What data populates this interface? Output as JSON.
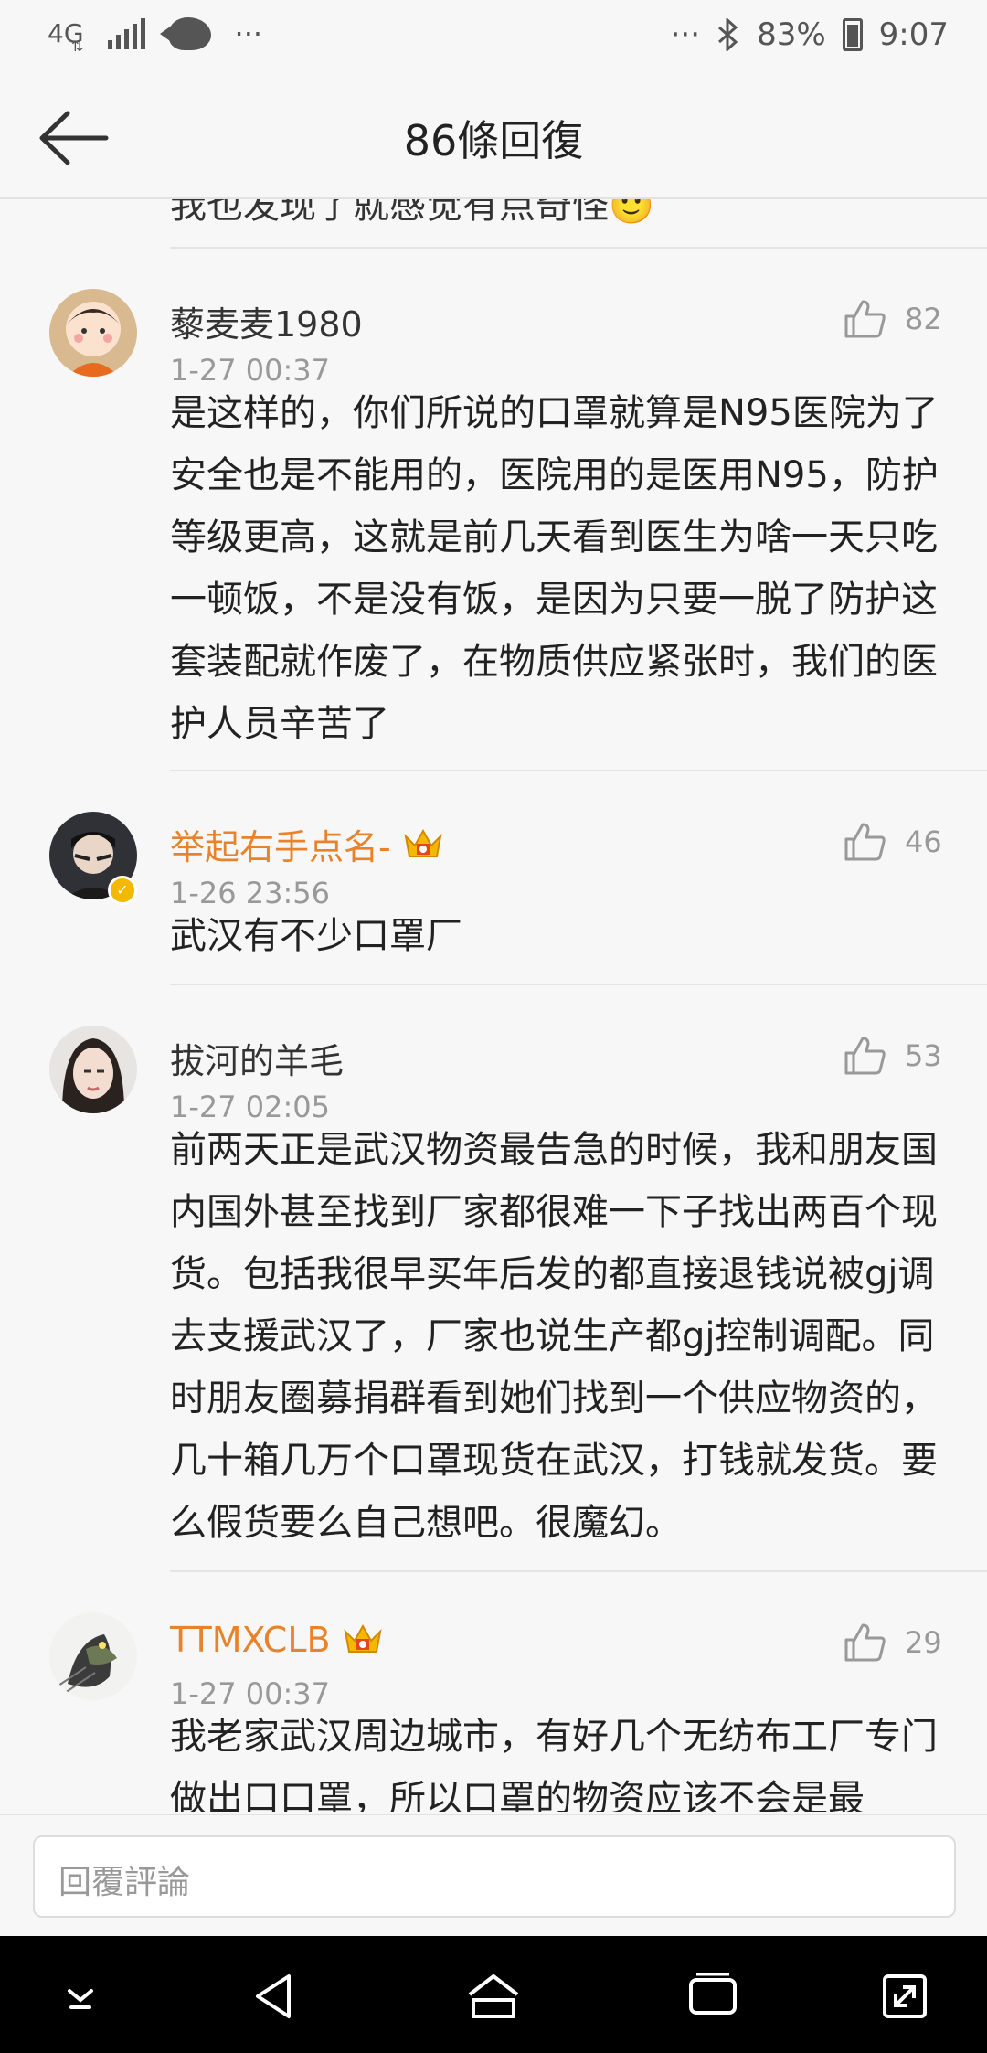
{
  "status_bar": {
    "network": "4G",
    "network_sub": "⇅",
    "more_left": "···",
    "more_right": "···",
    "battery_pct": "83%",
    "time": "9:07"
  },
  "header": {
    "title": "86條回復"
  },
  "partial_text": "我也发现了就感觉有点奇怪🙂",
  "comments": [
    {
      "username": "藜麦麦1980",
      "vip": false,
      "time": "1-27 00:37",
      "likes": "82",
      "text": "是这样的，你们所说的口罩就算是N95医院为了安全也是不能用的，医院用的是医用N95，防护等级更高，这就是前几天看到医生为啥一天只吃一顿饭，不是没有饭，是因为只要一脱了防护这套装配就作废了，在物质供应紧张时，我们的医护人员辛苦了"
    },
    {
      "username": "举起右手点名-",
      "vip": true,
      "time": "1-26 23:56",
      "likes": "46",
      "text": "武汉有不少口罩厂"
    },
    {
      "username": "拔河的羊毛",
      "vip": false,
      "time": "1-27 02:05",
      "likes": "53",
      "text": "前两天正是武汉物资最告急的时候，我和朋友国内国外甚至找到厂家都很难一下子找出两百个现货。包括我很早买年后发的都直接退钱说被gj调去支援武汉了，厂家也说生产都gj控制调配。同时朋友圈募捐群看到她们找到一个供应物资的，几十箱几万个口罩现货在武汉，打钱就发货。要么假货要么自己想吧。很魔幻。"
    },
    {
      "username": "TTMXCLB",
      "vip": true,
      "time": "1-27 00:37",
      "likes": "29",
      "text": "我老家武汉周边城市，有好几个无纺布工厂专门做出口口罩，所以口罩的物资应该不会是最"
    }
  ],
  "reply_bar": {
    "placeholder": "回覆評論"
  },
  "colors": {
    "vip_name": "#e8832c",
    "accent_gold": "#f5b800"
  },
  "icons": [
    "back-arrow-icon",
    "thumbs-up-icon",
    "crown-icon",
    "hide-keyboard-icon",
    "back-nav-icon",
    "home-nav-icon",
    "recents-nav-icon",
    "expand-nav-icon"
  ]
}
